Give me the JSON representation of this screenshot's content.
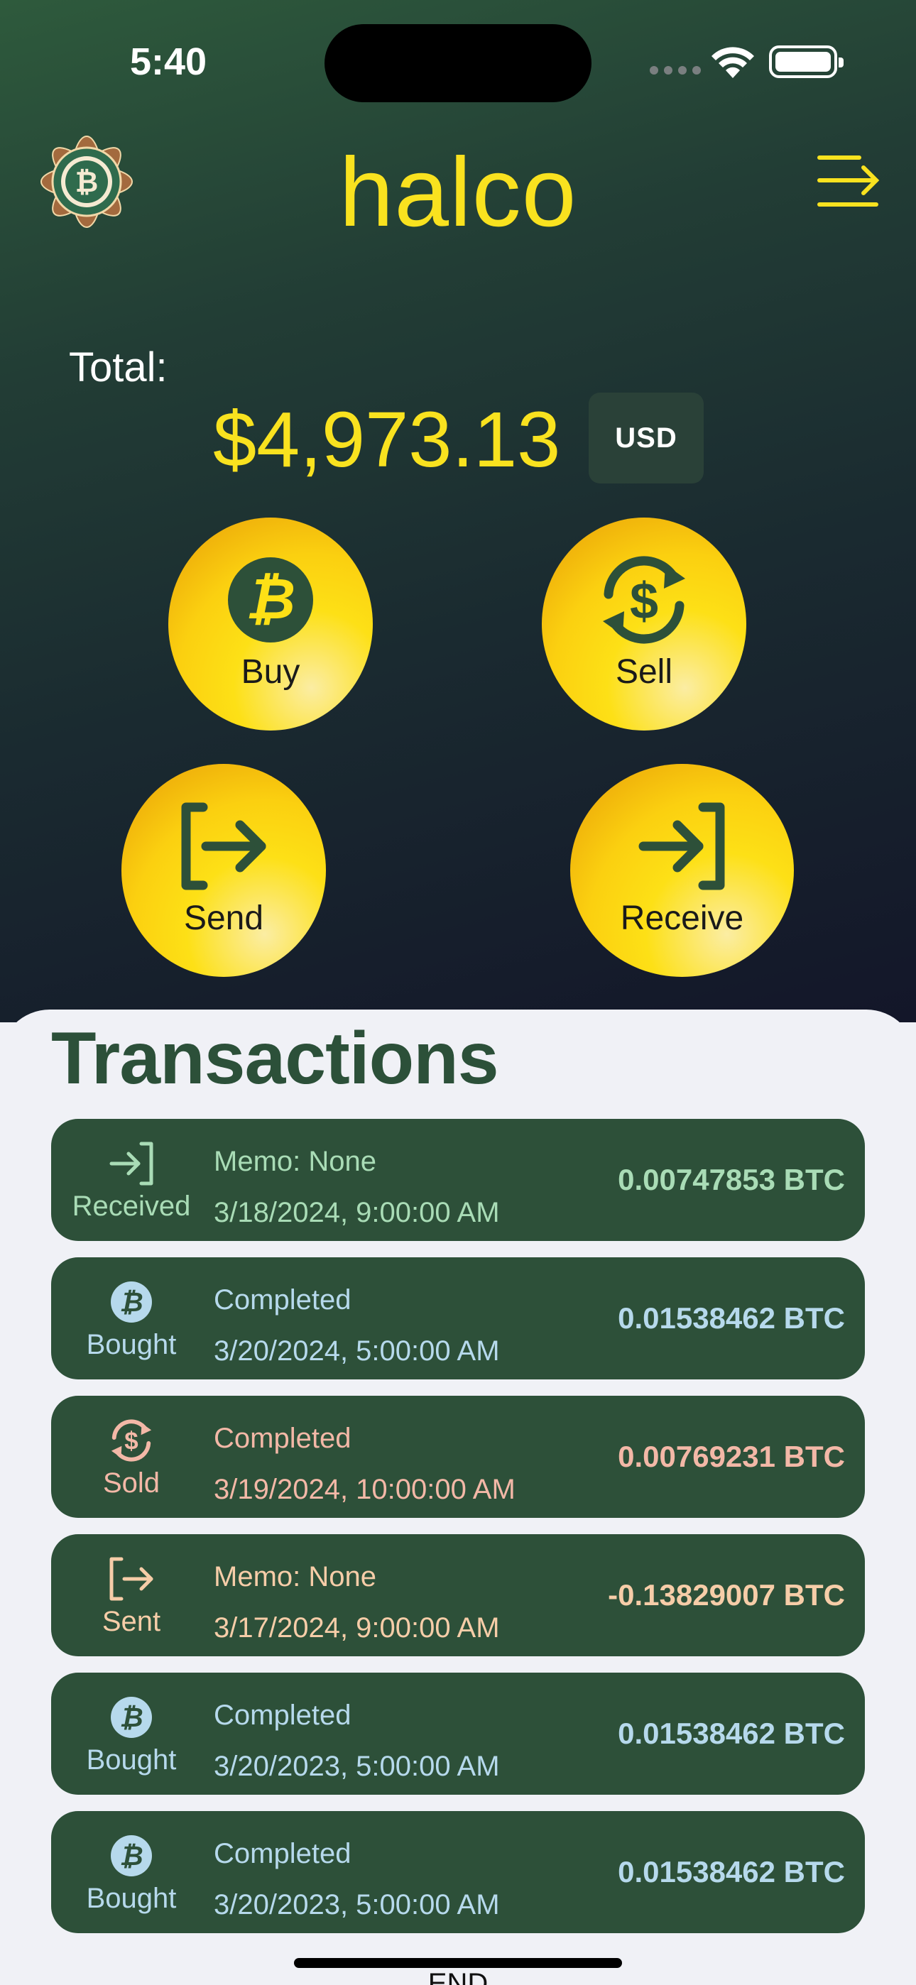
{
  "status_bar": {
    "time": "5:40"
  },
  "header": {
    "brand": "halco"
  },
  "balance": {
    "label": "Total:",
    "amount": "$4,973.13",
    "currency": "USD"
  },
  "actions": {
    "buy": "Buy",
    "sell": "Sell",
    "send": "Send",
    "receive": "Receive"
  },
  "transactions": {
    "title": "Transactions",
    "items": [
      {
        "type": "Received",
        "memo": "Memo: None",
        "date": "3/18/2024, 9:00:00 AM",
        "amount": "0.00747853 BTC",
        "icon": "receive-icon",
        "color": "#a9dcb6"
      },
      {
        "type": "Bought",
        "memo": "Completed",
        "date": "3/20/2024, 5:00:00 AM",
        "amount": "0.01538462 BTC",
        "icon": "bitcoin-icon",
        "color": "#b6d9ec"
      },
      {
        "type": "Sold",
        "memo": "Completed",
        "date": "3/19/2024, 10:00:00 AM",
        "amount": "0.00769231 BTC",
        "icon": "exchange-dollar-icon",
        "color": "#f3b8a7"
      },
      {
        "type": "Sent",
        "memo": "Memo: None",
        "date": "3/17/2024, 9:00:00 AM",
        "amount": "-0.13829007 BTC",
        "icon": "send-icon",
        "color": "#f6cda8"
      },
      {
        "type": "Bought",
        "memo": "Completed",
        "date": "3/20/2023, 5:00:00 AM",
        "amount": "0.01538462 BTC",
        "icon": "bitcoin-icon",
        "color": "#b6d9ec"
      },
      {
        "type": "Bought",
        "memo": "Completed",
        "date": "3/20/2023, 5:00:00 AM",
        "amount": "0.01538462 BTC",
        "icon": "bitcoin-icon",
        "color": "#b6d9ec"
      }
    ],
    "end_label": "END"
  },
  "colors": {
    "brand_yellow": "#f9e21f",
    "dark_green": "#2d5039",
    "sheet_bg": "#f0f1f6"
  }
}
